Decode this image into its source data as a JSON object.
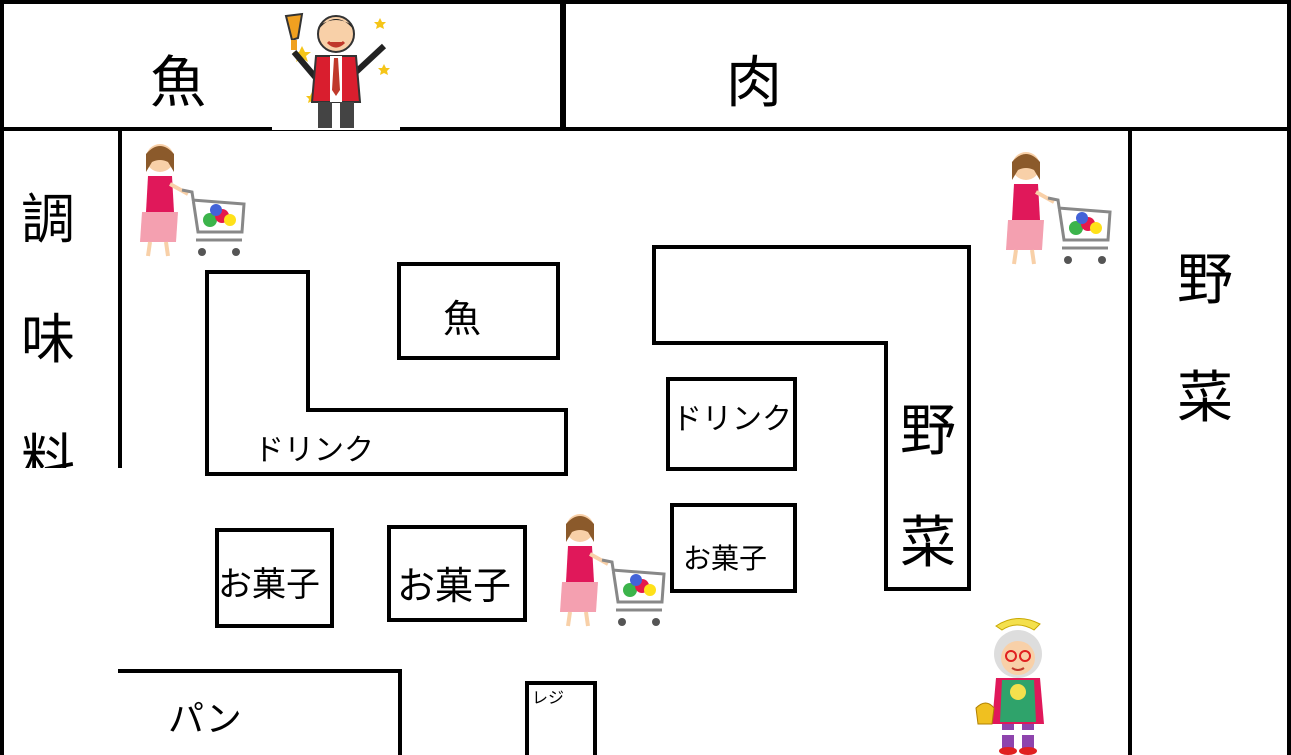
{
  "zones": {
    "fish_top": "魚",
    "meat_top": "肉",
    "seasoning": [
      "調",
      "味",
      "料"
    ],
    "vegetables_right": [
      "野",
      "菜"
    ],
    "bread": "パン",
    "register": "レジ"
  },
  "shelves": {
    "fish": "魚",
    "drink_l": "ドリンク",
    "drink_c": "ドリンク",
    "veg_c": [
      "野",
      "菜"
    ],
    "snack_1": "お菓子",
    "snack_2": "お菓子",
    "snack_3": "お菓子"
  },
  "illustrations": [
    "salesman-icon",
    "shopper-with-cart-icon",
    "shopper-with-cart-icon",
    "shopper-with-cart-icon",
    "safety-grandma-icon"
  ],
  "colors": {
    "line": "#000000",
    "background": "#ffffff",
    "shopper_top": "#e0185a"
  }
}
